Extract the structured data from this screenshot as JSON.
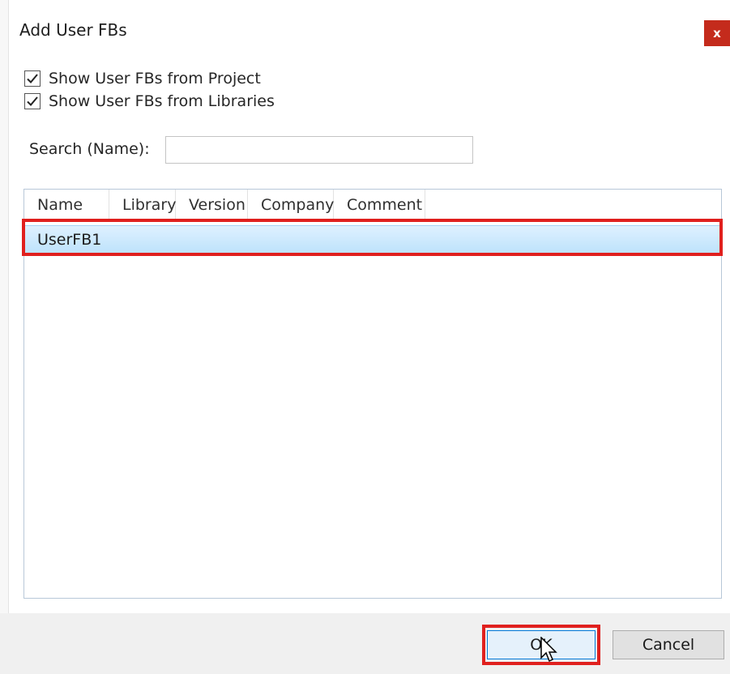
{
  "dialog": {
    "title": "Add User FBs",
    "close_label": "x"
  },
  "filters": {
    "show_project_label": "Show User FBs from Project",
    "show_project_checked": true,
    "show_libraries_label": "Show User FBs from Libraries",
    "show_libraries_checked": true
  },
  "search": {
    "label": "Search (Name):",
    "value": ""
  },
  "list": {
    "columns": [
      "Name",
      "Library",
      "Version",
      "Company",
      "Comment"
    ],
    "rows": [
      {
        "name": "UserFB1",
        "library": "",
        "version": "",
        "company": "",
        "comment": "",
        "selected": true
      }
    ]
  },
  "buttons": {
    "ok_label": "OK",
    "cancel_label": "Cancel"
  },
  "colors": {
    "highlight": "#e0201e",
    "selection": "#bde2fb",
    "close_button": "#c42b1c"
  }
}
